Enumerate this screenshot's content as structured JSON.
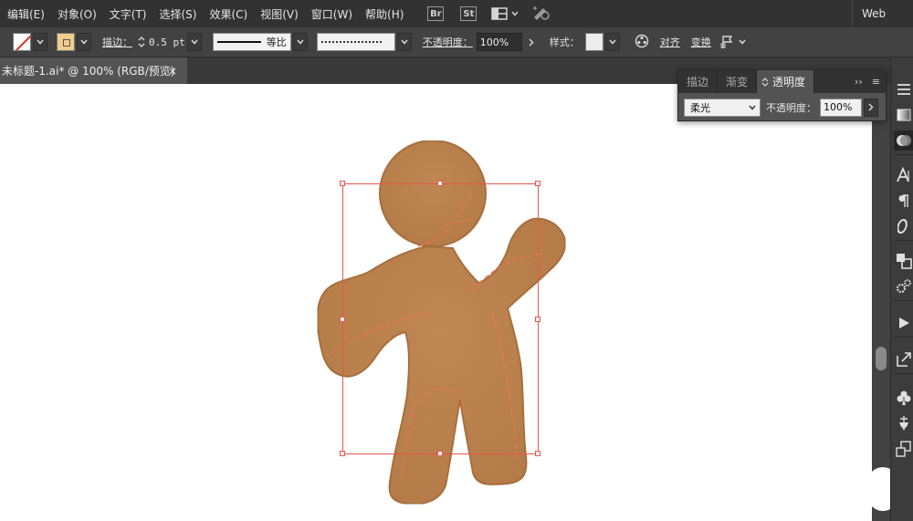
{
  "menubar": {
    "items": [
      "编辑(E)",
      "对象(O)",
      "文字(T)",
      "选择(S)",
      "效果(C)",
      "视图(V)",
      "窗口(W)",
      "帮助(H)"
    ],
    "bridge_badge": "Br",
    "stock_badge": "St",
    "workspace": "Web"
  },
  "controlbar": {
    "stroke_label": "描边：",
    "stroke_weight": "0.5 pt",
    "profile_label": "等比",
    "opacity_label": "不透明度：",
    "opacity_value": "100%",
    "style_label": "样式：",
    "align_label": "对齐",
    "transform_label": "变换"
  },
  "document": {
    "tab_title": "未标题-1.ai* @ 100% (RGB/预览)",
    "close_glyph": "×"
  },
  "panel": {
    "tabs": [
      "描边",
      "渐变",
      "透明度"
    ],
    "active_tab": "透明度",
    "collapse_glyph": "››",
    "menu_glyph": "≡",
    "blend_mode": "柔光",
    "opacity_label": "不透明度：",
    "opacity_value": "100%"
  },
  "colors": {
    "cookie_fill": "#c0824e",
    "cookie_edge": "#a86c3a",
    "selection": "#e8554a",
    "fill_swatch": "#f1cd8a"
  },
  "icons": [
    "arrange-documents-icon",
    "gpu-performance-icon",
    "recolor-artwork-icon",
    "puppet-flag-icon"
  ]
}
